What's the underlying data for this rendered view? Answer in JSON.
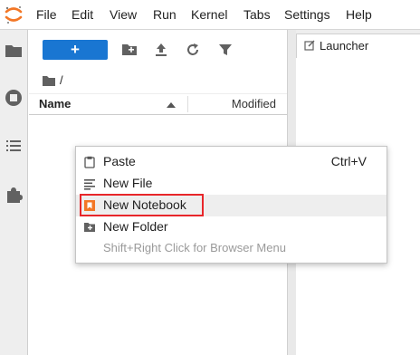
{
  "menubar": {
    "items": [
      "File",
      "Edit",
      "View",
      "Run",
      "Kernel",
      "Tabs",
      "Settings",
      "Help"
    ]
  },
  "icons": {
    "logo": "jupyter-logo-icon",
    "activity": [
      "folder-icon",
      "running-stop-icon",
      "command-list-icon",
      "extension-puzzle-icon"
    ],
    "toolbar": [
      "plus-icon",
      "new-folder-icon",
      "upload-icon",
      "refresh-icon",
      "filter-icon"
    ]
  },
  "filebrowser": {
    "new_launcher_label": "+",
    "breadcrumb": "/",
    "columns": {
      "name": "Name",
      "modified": "Modified"
    }
  },
  "main": {
    "tabs": [
      {
        "label": "Launcher"
      }
    ]
  },
  "context_menu": {
    "items": [
      {
        "label": "Paste",
        "shortcut": "Ctrl+V",
        "icon": "clipboard-icon"
      },
      {
        "label": "New File",
        "shortcut": "",
        "icon": "text-file-icon"
      },
      {
        "label": "New Notebook",
        "shortcut": "",
        "icon": "notebook-icon",
        "highlighted": true
      },
      {
        "label": "New Folder",
        "shortcut": "",
        "icon": "new-folder-icon"
      },
      {
        "label": "Shift+Right Click for Browser Menu",
        "shortcut": "",
        "disabled": true
      }
    ]
  },
  "colors": {
    "accent": "#1976d2",
    "notebook_orange": "#f37726",
    "highlight_frame": "#e8262a"
  }
}
